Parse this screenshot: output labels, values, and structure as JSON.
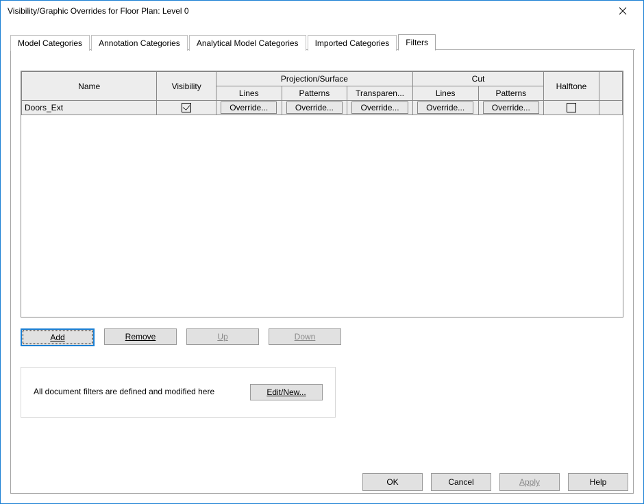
{
  "window": {
    "title": "Visibility/Graphic Overrides for Floor Plan: Level 0"
  },
  "tabs": {
    "t0": "Model Categories",
    "t1": "Annotation Categories",
    "t2": "Analytical Model Categories",
    "t3": "Imported Categories",
    "t4": "Filters",
    "active": "t4"
  },
  "grid": {
    "headers": {
      "name": "Name",
      "visibility": "Visibility",
      "projection_surface": "Projection/Surface",
      "cut": "Cut",
      "halftone": "Halftone",
      "proj_lines": "Lines",
      "proj_patterns": "Patterns",
      "proj_transparency": "Transparen...",
      "cut_lines": "Lines",
      "cut_patterns": "Patterns"
    },
    "rows": [
      {
        "name": "Doors_Ext",
        "visibility": true,
        "proj_lines": "Override...",
        "proj_patterns": "Override...",
        "proj_transparency": "Override...",
        "cut_lines": "Override...",
        "cut_patterns": "Override...",
        "halftone": false
      }
    ]
  },
  "buttons": {
    "add": "Add",
    "remove": "Remove",
    "up": "Up",
    "down": "Down",
    "edit_new": "Edit/New..."
  },
  "info_text": "All document filters are defined and modified here",
  "footer": {
    "ok": "OK",
    "cancel": "Cancel",
    "apply": "Apply",
    "help": "Help"
  }
}
